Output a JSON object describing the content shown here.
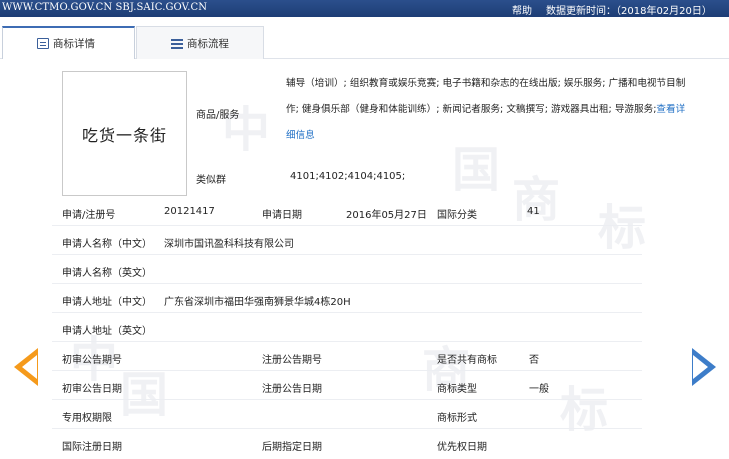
{
  "topbar": {
    "site": "WWW.CTMO.GOV.CN SBJ.SAIC.GOV.CN",
    "help": "帮助",
    "update": "数据更新时间：（2018年02月20日）"
  },
  "tabs": [
    {
      "label": "商标详情",
      "active": true
    },
    {
      "label": "商标流程",
      "active": false
    }
  ],
  "trademark": {
    "name": "吃货一条街",
    "goods_label": "商品/服务",
    "goods_text": "辅导（培训）; 组织教育或娱乐竞赛; 电子书籍和杂志的在线出版; 娱乐服务; 广播和电视节目制作; 健身俱乐部（健身和体能训练）; 新闻记者服务; 文稿撰写; 游戏器具出租; 导游服务;",
    "goods_link": "查看详细信息",
    "similar_label": "类似群",
    "similar_value": "4101;4102;4104;4105;"
  },
  "fields": {
    "reg_no_label": "申请/注册号",
    "reg_no": "20121417",
    "apply_date_label": "申请日期",
    "apply_date": "2016年05月27日",
    "intl_class_label": "国际分类",
    "intl_class": "41",
    "applicant_cn_label": "申请人名称（中文）",
    "applicant_cn": "深圳市国讯盈科科技有限公司",
    "applicant_en_label": "申请人名称（英文）",
    "applicant_en": "",
    "address_cn_label": "申请人地址（中文）",
    "address_cn": "广东省深圳市福田华强南狮景华城4栋20H",
    "address_en_label": "申请人地址（英文）",
    "address_en": "",
    "prelim_no_label": "初审公告期号",
    "prelim_no": "",
    "reg_pub_no_label": "注册公告期号",
    "reg_pub_no": "",
    "shared_label": "是否共有商标",
    "shared": "否",
    "prelim_date_label": "初审公告日期",
    "prelim_date": "",
    "reg_pub_date_label": "注册公告日期",
    "reg_pub_date": "",
    "type_label": "商标类型",
    "type": "一般",
    "exclusive_label": "专用权期限",
    "exclusive": "",
    "form_label": "商标形式",
    "form": "",
    "intl_reg_date_label": "国际注册日期",
    "intl_reg_date": "",
    "later_date_label": "后期指定日期",
    "later_date": "",
    "priority_date_label": "优先权日期",
    "priority_date": ""
  },
  "watermark": [
    "中",
    "国",
    "商",
    "标",
    "中",
    "国",
    "商",
    "标"
  ]
}
